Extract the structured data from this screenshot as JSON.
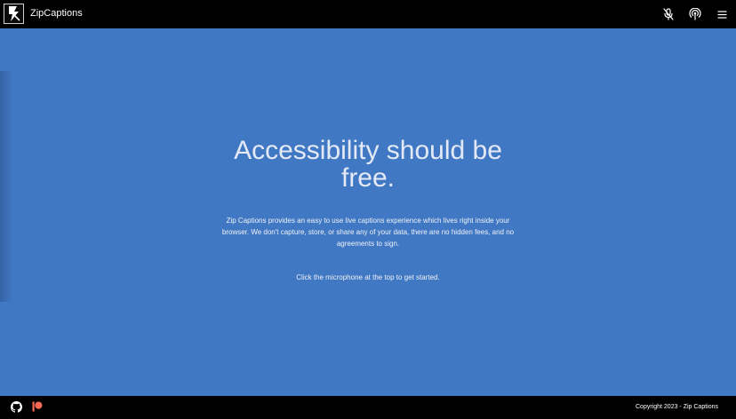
{
  "header": {
    "brand": "ZipCaptions",
    "icons": [
      "zipcaptions-logo-icon",
      "microphone-icon",
      "broadcast-icon",
      "menu-icon"
    ]
  },
  "main": {
    "headline": "Accessibility should be free.",
    "tagline": "Zip Captions provides an easy to use live captions experience which lives right inside your browser. We don't capture, store, or share any of your data, there are no hidden fees, and no agreements to sign.",
    "hint": "Click the microphone at the top to get started."
  },
  "footer": {
    "copyright": "Copyright 2023 - Zip Captions",
    "icons": [
      "github-icon",
      "patreon-icon"
    ]
  },
  "colors": {
    "background": "#4178c3",
    "bars": "#000000",
    "patreon": "#f96854"
  }
}
